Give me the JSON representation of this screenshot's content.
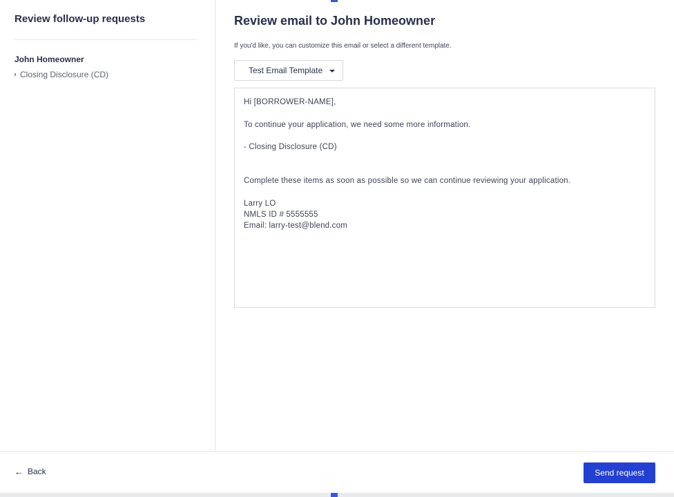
{
  "sidebar": {
    "title": "Review follow-up requests",
    "borrower": "John Homeowner",
    "requests": [
      "Closing Disclosure (CD)"
    ]
  },
  "main": {
    "title": "Review email to John Homeowner",
    "subtitle": "If you'd like, you can customize this email or select a different template.",
    "template_select": {
      "value": "Test Email Template"
    },
    "email_lines": [
      "Hi [BORROWER-NAME],",
      "",
      "To continue your application, we need some more information.",
      "",
      "- Closing Disclosure (CD)",
      "",
      "",
      "Complete these items as soon as possible so we can continue reviewing your application.",
      "",
      "Larry LO",
      "NMLS ID # 5555555",
      "Email: larry-test@blend.com"
    ]
  },
  "footer": {
    "back_label": "Back",
    "send_label": "Send request"
  },
  "colors": {
    "primary": "#2440d1",
    "text": "#2a2f4a",
    "border": "#e3e5ea"
  },
  "icons": {
    "back": "arrow-left-icon",
    "dropdown": "caret-down-icon"
  }
}
